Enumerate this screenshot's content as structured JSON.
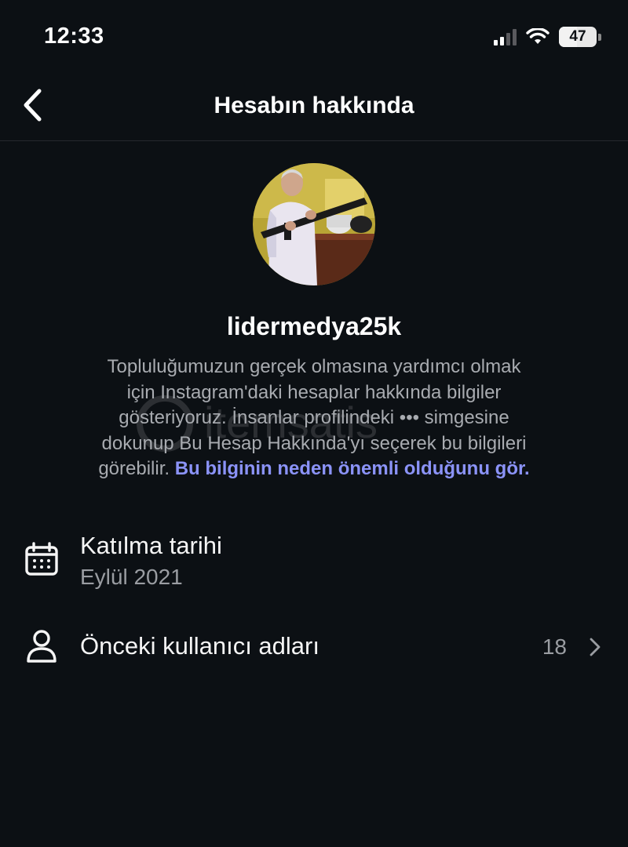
{
  "status_bar": {
    "time": "12:33",
    "battery": "47",
    "battery_fraction": 0.47
  },
  "nav": {
    "title": "Hesabın hakkında",
    "back_icon": "chevron-left-icon"
  },
  "profile": {
    "username": "lidermedya25k",
    "description_lines": [
      "Topluluğumuzun gerçek olmasına yardımcı olmak",
      "için Instagram'daki hesaplar hakkında bilgiler",
      "gösteriyoruz. İnsanlar profilindeki ••• simgesine",
      "dokunup Bu Hesap Hakkında'yı seçerek bu bilgileri",
      "görebilir."
    ],
    "learn_more_link": "Bu bilginin neden önemli olduğunu gör."
  },
  "rows": {
    "date_joined": {
      "title": "Katılma tarihi",
      "value": "Eylül 2021",
      "icon": "calendar-icon"
    },
    "former_usernames": {
      "title": "Önceki kullanıcı adları",
      "count": "18",
      "icon": "person-icon"
    }
  },
  "colors": {
    "background": "#0c1014",
    "link": "#8b93f8",
    "secondary_text": "#9a9da2"
  }
}
